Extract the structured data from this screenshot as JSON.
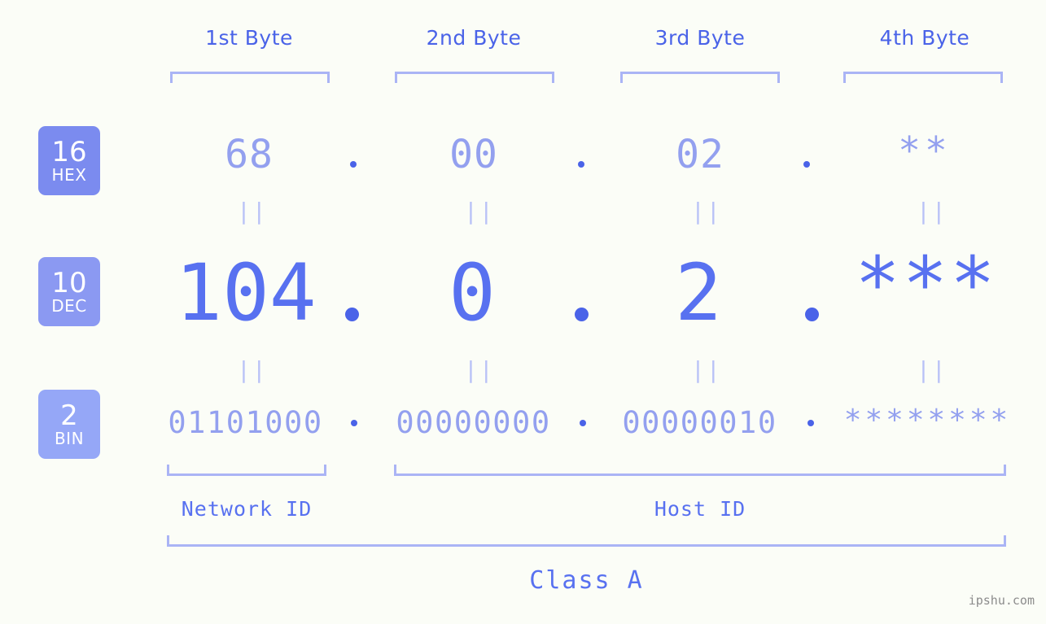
{
  "background_color": "#fbfdf7",
  "accent_color": "#4a63e8",
  "colors": {
    "header_text": "#4a63e8",
    "bracket": "#aab4f5",
    "hex_value": "#93a0ef",
    "dec_value": "#5871f0",
    "bin_value": "#93a0ef",
    "badge_hex": "#7b8bef",
    "badge_dec": "#8b99f2",
    "badge_bin": "#95a7f7",
    "equals_mark": "#b9c2f7",
    "watermark": "#8c8c8c"
  },
  "byte_headers": [
    {
      "label": "1st Byte"
    },
    {
      "label": "2nd Byte"
    },
    {
      "label": "3rd Byte"
    },
    {
      "label": "4th Byte"
    }
  ],
  "bases": [
    {
      "num": "16",
      "label": "HEX"
    },
    {
      "num": "10",
      "label": "DEC"
    },
    {
      "num": "2",
      "label": "BIN"
    }
  ],
  "rows": {
    "hex": {
      "values": [
        "68",
        "00",
        "02",
        "**"
      ]
    },
    "dec": {
      "values": [
        "104",
        "0",
        "2",
        "***"
      ]
    },
    "bin": {
      "values": [
        "01101000",
        "00000000",
        "00000010",
        "********"
      ]
    }
  },
  "separator": ".",
  "equals_mark": "||",
  "id_labels": [
    {
      "label": "Network ID"
    },
    {
      "label": "Host ID"
    }
  ],
  "class_label": "Class A",
  "watermark": "ipshu.com"
}
